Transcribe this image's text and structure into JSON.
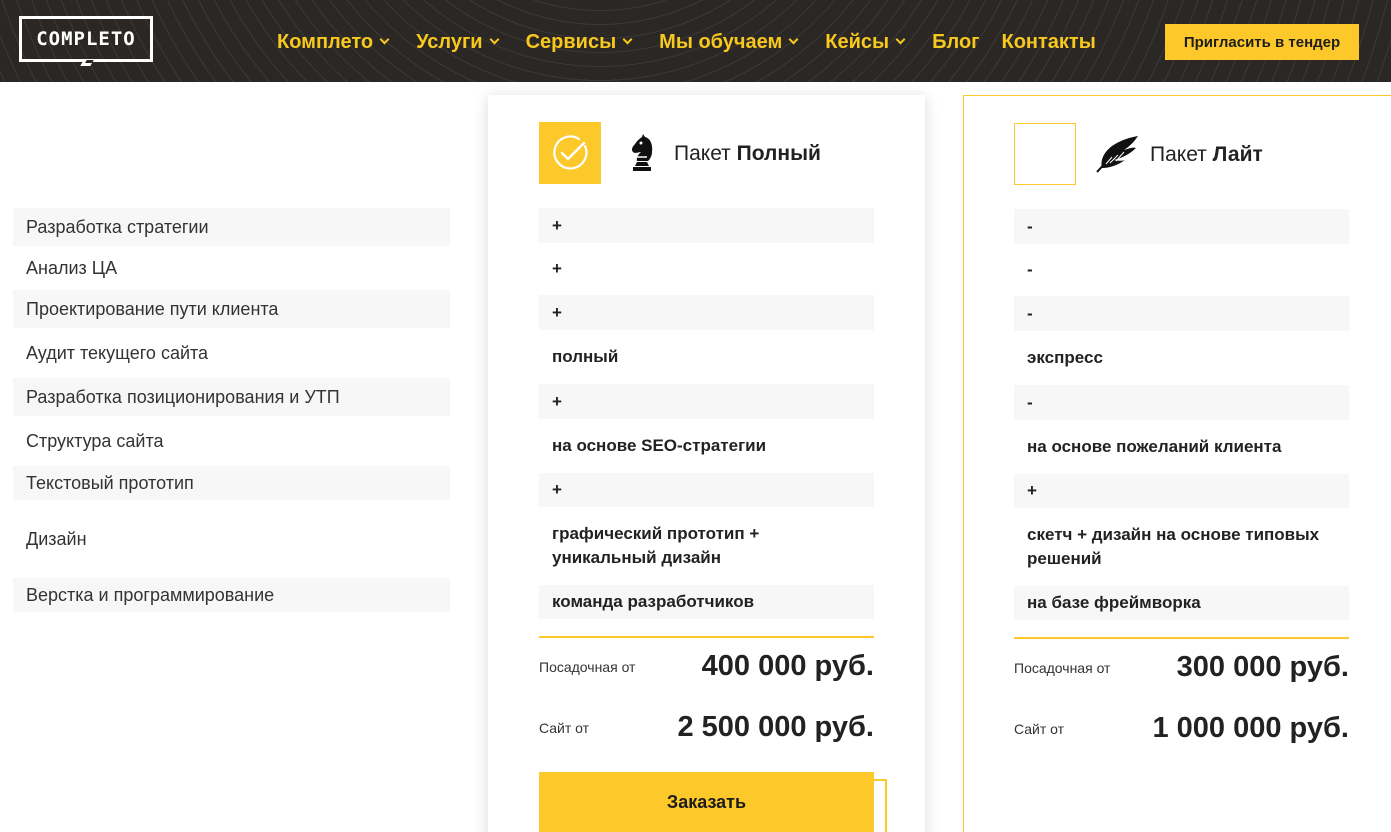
{
  "header": {
    "logo_text": "COMPLETO",
    "nav": [
      {
        "label": "Комплето",
        "has_dropdown": true
      },
      {
        "label": "Услуги",
        "has_dropdown": true
      },
      {
        "label": "Сервисы",
        "has_dropdown": true
      },
      {
        "label": "Мы обучаем",
        "has_dropdown": true
      },
      {
        "label": "Кейсы",
        "has_dropdown": true
      },
      {
        "label": "Блог",
        "has_dropdown": false
      },
      {
        "label": "Контакты",
        "has_dropdown": false
      }
    ],
    "tender_button": "Пригласить в тендер"
  },
  "features": [
    "Разработка стратегии",
    "Анализ ЦА",
    "Проектирование пути клиента",
    "Аудит текущего сайта",
    "Разработка позиционирования и УТП",
    "Структура сайта",
    "Текстовый прототип",
    "Дизайн",
    "Верстка и программирование"
  ],
  "packages": {
    "full": {
      "title_prefix": "Пакет",
      "title_name": "Полный",
      "selected": true,
      "icon": "chess-knight-icon",
      "rows": [
        "+",
        "+",
        "+",
        "полный",
        "+",
        "на основе SEO-стратегии",
        "+",
        "графический прототип + уникальный дизайн",
        "команда разработчиков"
      ],
      "landing_label": "Посадочная от",
      "landing_price": "400 000 руб.",
      "site_label": "Сайт от",
      "site_price": "2 500 000 руб.",
      "order_button": "Заказать"
    },
    "lite": {
      "title_prefix": "Пакет",
      "title_name": "Лайт",
      "selected": false,
      "icon": "feather-icon",
      "rows": [
        "-",
        "-",
        "-",
        "экспресс",
        "-",
        "на основе пожеланий клиента",
        "+",
        "скетч + дизайн на основе типовых решений",
        "на базе фреймворка"
      ],
      "landing_label": "Посадочная от",
      "landing_price": "300 000 руб.",
      "site_label": "Сайт от",
      "site_price": "1 000 000 руб."
    }
  },
  "colors": {
    "accent": "#fdc829",
    "header_bg": "#2b2724",
    "nav_text": "#f7c81e",
    "row_shade": "#f7f7f7"
  }
}
